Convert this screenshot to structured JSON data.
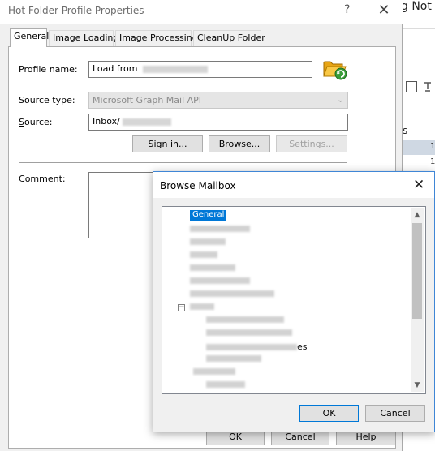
{
  "background_app": {
    "title": "g Not",
    "column_label": "s",
    "row_value_1": "1",
    "row_value_2": "1"
  },
  "main_dialog": {
    "title": "Hot Folder Profile Properties",
    "help_glyph": "?",
    "close_glyph": "✕",
    "tabs": [
      {
        "label": "General",
        "active": true
      },
      {
        "label": "Image Loading",
        "active": false
      },
      {
        "label": "Image Processing",
        "active": false
      },
      {
        "label": "CleanUp Folder",
        "active": false
      }
    ],
    "profile_name_label": "Profile name:",
    "profile_name_value": "Load from",
    "source_type_label": "Source type:",
    "source_type_value": "Microsoft Graph Mail API",
    "source_label": "Source:",
    "source_value": "Inbox/",
    "sign_in_label": "Sign in...",
    "browse_label": "Browse...",
    "settings_label": "Settings...",
    "comment_label": "Comment:",
    "ok_label": "OK",
    "cancel_label": "Cancel",
    "help_label": "Help",
    "folder_icon": "folder-refresh-icon"
  },
  "browse_dialog": {
    "title": "Browse Mailbox",
    "close_glyph": "✕",
    "selected_item": "General",
    "expander_glyph": "−",
    "visible_suffix": "es",
    "ok_label": "OK",
    "cancel_label": "Cancel"
  },
  "colors": {
    "selection": "#0078d7",
    "dialog_bg": "#f0f0f0",
    "focus_border": "#3f86d6"
  }
}
